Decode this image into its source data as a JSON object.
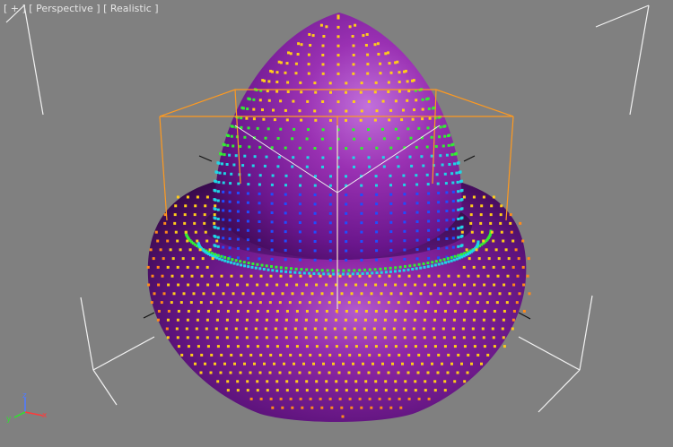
{
  "viewport": {
    "menu_label": "[ + ]",
    "view_label": "[ Perspective ]",
    "shading_label": "[ Realistic ]"
  },
  "axes": {
    "x_label": "x",
    "y_label": "y",
    "z_label": "z",
    "x_color": "#ff3a3a",
    "y_color": "#33dd33",
    "z_color": "#4f7bff"
  },
  "colors": {
    "background": "#808080",
    "grid_lines": "#f2f2f2",
    "bounding_box": "#ff9a1f",
    "surface_main": "#8a1f9e",
    "surface_highlight": "#c070d8",
    "surface_shadow": "#360c47"
  },
  "vertex_colors": {
    "low": "#1f4dff",
    "mid_low": "#1fd6e6",
    "mid": "#33ee33",
    "high": "#ffcc1a",
    "edge": "#ff8a1a"
  }
}
